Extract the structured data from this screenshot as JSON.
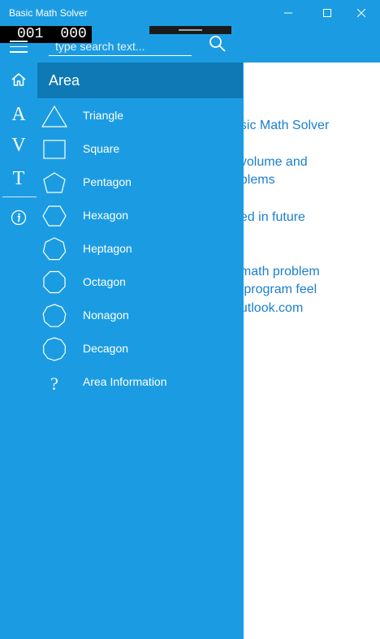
{
  "window": {
    "title": "Basic Math Solver",
    "controls": {
      "minimize": "—",
      "maximize": "☐",
      "close": "✕"
    }
  },
  "overlay": {
    "counter_left": "001",
    "counter_right": "000"
  },
  "search": {
    "placeholder": "type search text..."
  },
  "rail": {
    "items": [
      {
        "kind": "icon",
        "icon": "home-icon"
      },
      {
        "kind": "letter",
        "label": "A"
      },
      {
        "kind": "letter",
        "label": "V"
      },
      {
        "kind": "letter",
        "label": "T"
      },
      {
        "kind": "icon",
        "icon": "info-icon"
      }
    ]
  },
  "pane": {
    "header": "Area",
    "items": [
      {
        "label": "Triangle",
        "icon": "triangle-icon"
      },
      {
        "label": "Square",
        "icon": "square-icon"
      },
      {
        "label": "Pentagon",
        "icon": "pentagon-icon"
      },
      {
        "label": "Hexagon",
        "icon": "hexagon-icon"
      },
      {
        "label": "Heptagon",
        "icon": "heptagon-icon"
      },
      {
        "label": "Octagon",
        "icon": "octagon-icon"
      },
      {
        "label": "Nonagon",
        "icon": "nonagon-icon"
      },
      {
        "label": "Decagon",
        "icon": "decagon-icon"
      },
      {
        "label": "Area Information",
        "icon": "question-icon"
      }
    ]
  },
  "content": {
    "lines": [
      "asic Math Solver",
      ", volume and",
      "oblems",
      "ded in future",
      ", math problem",
      "e program feel",
      "outlook.com"
    ]
  },
  "colors": {
    "accent": "#1b9ce2",
    "pane_header": "#0f79b5",
    "content_text": "#1a7fd0"
  }
}
